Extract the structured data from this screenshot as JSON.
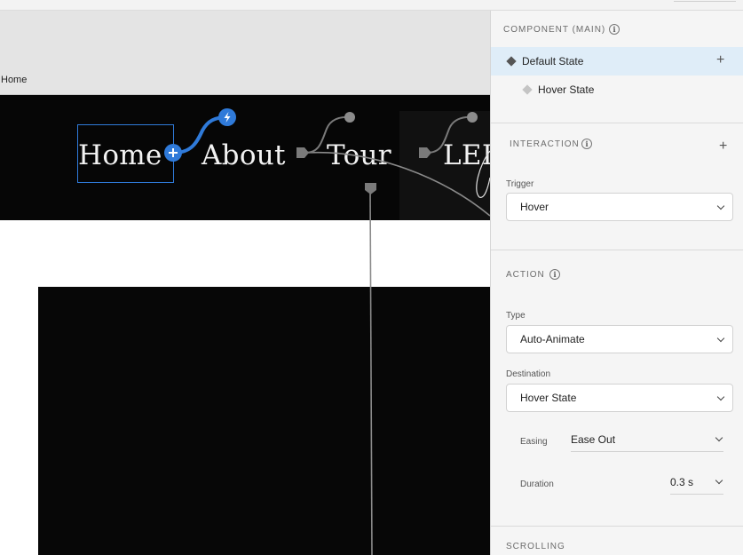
{
  "canvas": {
    "artboard_label": "Home",
    "nav": {
      "home": "Home",
      "about": "About",
      "tour": "Tour",
      "logo": "LEI"
    }
  },
  "panel": {
    "component": {
      "heading": "COMPONENT (MAIN)",
      "states": [
        {
          "label": "Default State"
        },
        {
          "label": "Hover State"
        }
      ]
    },
    "interaction": {
      "heading": "INTERACTION",
      "trigger_label": "Trigger",
      "trigger_value": "Hover"
    },
    "action": {
      "heading": "ACTION",
      "type_label": "Type",
      "type_value": "Auto-Animate",
      "destination_label": "Destination",
      "destination_value": "Hover State",
      "easing_label": "Easing",
      "easing_value": "Ease Out",
      "duration_label": "Duration",
      "duration_value": "0.3 s"
    },
    "scrolling": {
      "heading": "SCROLLING"
    }
  },
  "colors": {
    "accent": "#2f7ad9",
    "selection_row": "#dfedf8",
    "navbar": "#060606"
  }
}
